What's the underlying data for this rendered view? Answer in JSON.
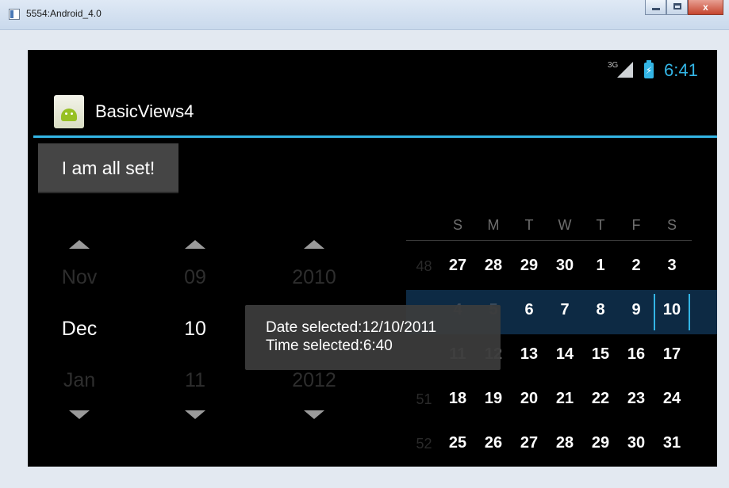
{
  "window": {
    "title": "5554:Android_4.0",
    "close_glyph": "x"
  },
  "status": {
    "network": "3G",
    "battery_glyph": "⚡",
    "time": "6:41",
    "accent": "#33b5e5"
  },
  "app": {
    "title": "BasicViews4"
  },
  "button": {
    "label": "I am all set!"
  },
  "date_picker": {
    "month": {
      "prev": "Nov",
      "current": "Dec",
      "next": "Jan"
    },
    "day": {
      "prev": "09",
      "current": "10",
      "next": "11"
    },
    "year": {
      "prev": "2010",
      "current": "",
      "next": "2012"
    }
  },
  "calendar": {
    "days_of_week": [
      "S",
      "M",
      "T",
      "W",
      "T",
      "F",
      "S"
    ],
    "weeks": [
      {
        "num": "48",
        "days": [
          "27",
          "28",
          "29",
          "30",
          "1",
          "2",
          "3"
        ]
      },
      {
        "num": "",
        "days": [
          "4",
          "5",
          "6",
          "7",
          "8",
          "9",
          "10"
        ]
      },
      {
        "num": "",
        "days": [
          "11",
          "12",
          "13",
          "14",
          "15",
          "16",
          "17"
        ]
      },
      {
        "num": "51",
        "days": [
          "18",
          "19",
          "20",
          "21",
          "22",
          "23",
          "24"
        ]
      },
      {
        "num": "52",
        "days": [
          "25",
          "26",
          "27",
          "28",
          "29",
          "30",
          "31"
        ]
      }
    ],
    "selected_day": "10"
  },
  "toast": {
    "line1": "Date selected:12/10/2011",
    "line2": "Time selected:6:40"
  }
}
